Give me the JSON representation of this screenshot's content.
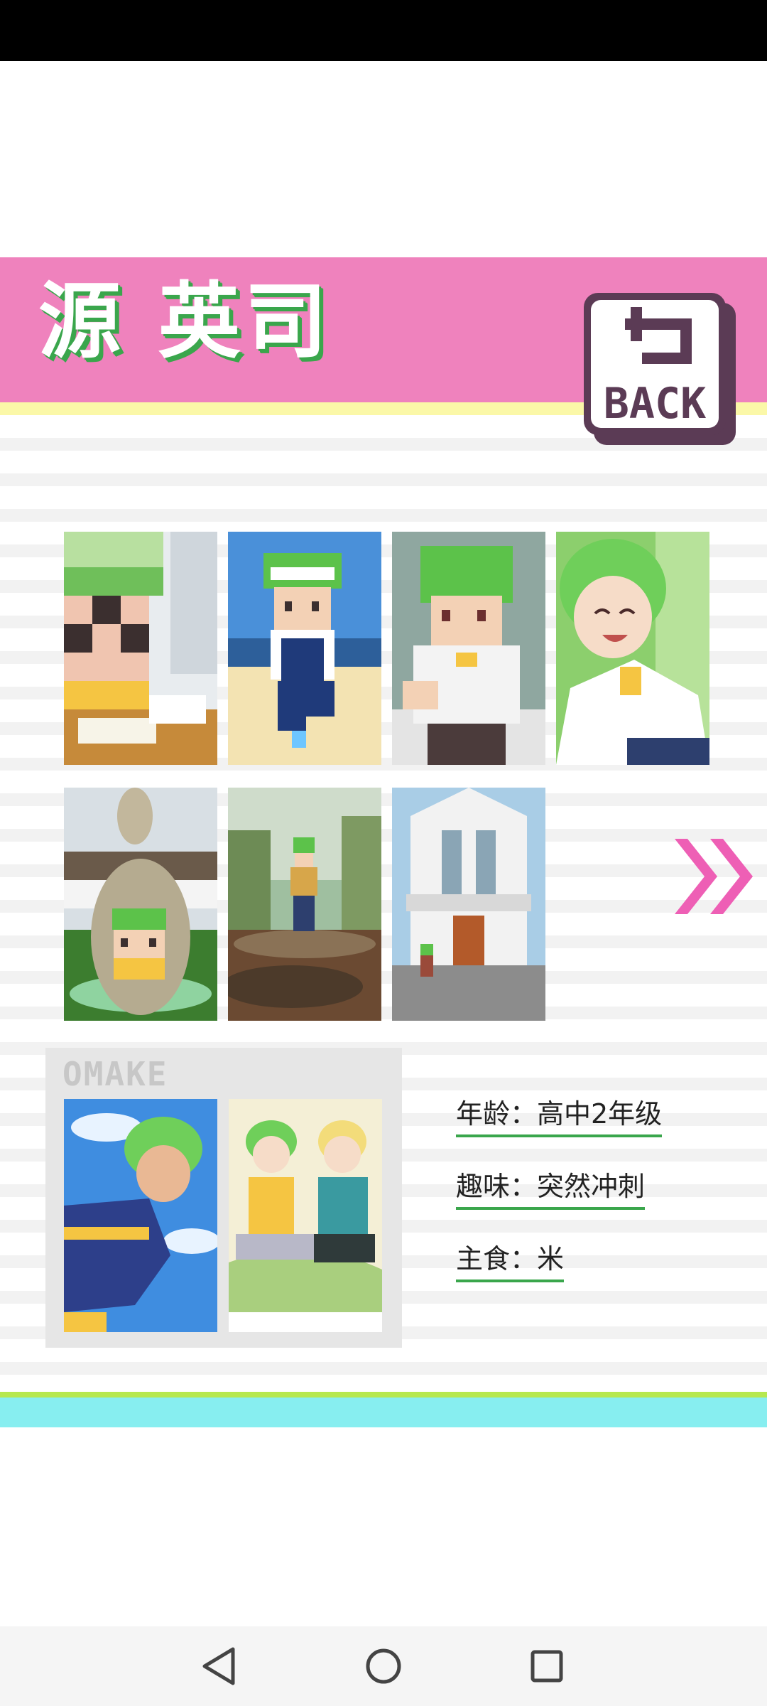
{
  "character": {
    "name": "源 英司"
  },
  "back_button": {
    "label": "BACK",
    "icon": "return-arrow-icon"
  },
  "gallery": {
    "row1": [
      "pixel-desk-study",
      "pixel-boy-running",
      "pixel-boy-reaching",
      "anime-boy-smiling"
    ],
    "row2": [
      "kangaroo-statue-pixel",
      "forest-stream-photo",
      "church-building-photo"
    ]
  },
  "next_arrow": {
    "icon": "double-chevron-right-icon"
  },
  "omake": {
    "title": "OMAKE",
    "images": [
      "runner-anime-art",
      "two-boys-gaming-art"
    ]
  },
  "profile": {
    "age": "年龄：高中2年级",
    "hobby": "趣味：突然冲刺",
    "staple_food": "主食：米"
  },
  "colors": {
    "header_pink": "#ef82bd",
    "name_shadow_green": "#3aa64c",
    "accent_pink": "#ee5fb5",
    "underline_green": "#3aa64c",
    "footer_cyan": "#87eef0",
    "footer_lime": "#b6e84f"
  },
  "nav": {
    "back_icon": "triangle-back-icon",
    "home_icon": "circle-home-icon",
    "recents_icon": "square-recents-icon"
  }
}
